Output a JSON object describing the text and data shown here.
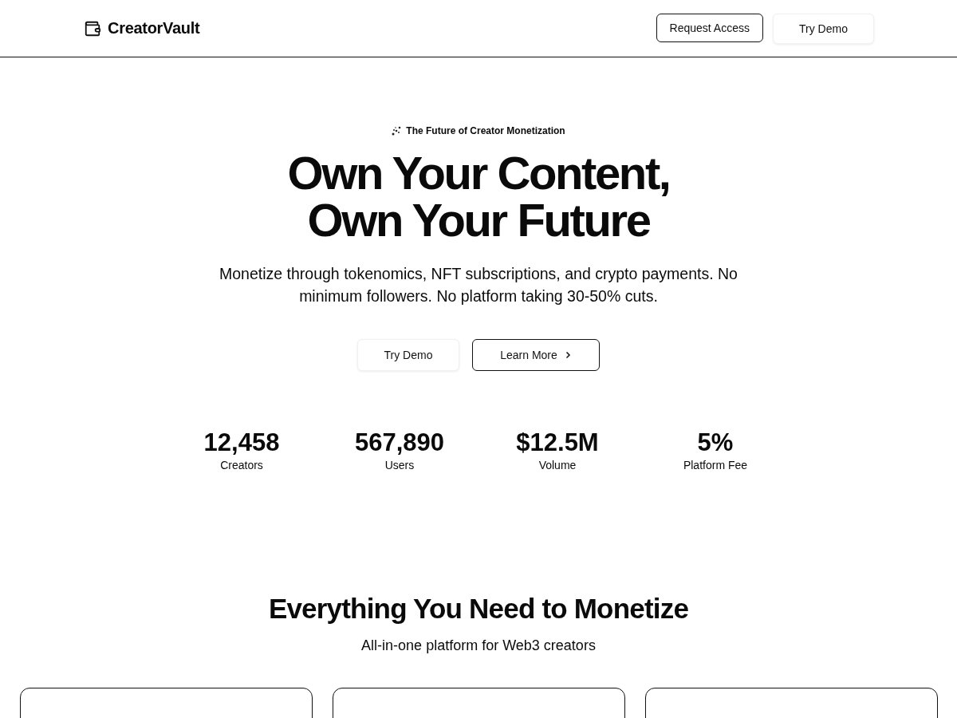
{
  "header": {
    "brand": "CreatorVault",
    "buttons": [
      {
        "label": "Request Access",
        "kind": "outline"
      },
      {
        "label": "Try Demo",
        "kind": "soft"
      }
    ]
  },
  "hero": {
    "badge": "The Future of Creator Monetization",
    "title_lines": [
      "Own Your Content,",
      "Own Your Future"
    ],
    "subtitle": "Monetize through tokenomics, NFT subscriptions, and crypto payments. No minimum followers. No platform taking 30-50% cuts.",
    "buttons": [
      {
        "label": "Try Demo",
        "kind": "soft"
      },
      {
        "label": "Learn More",
        "kind": "outline"
      }
    ]
  },
  "stats": [
    {
      "value": "12,458",
      "label": "Creators"
    },
    {
      "value": "567,890",
      "label": "Users"
    },
    {
      "value": "$12.5M",
      "label": "Volume"
    },
    {
      "value": "5%",
      "label": "Platform Fee"
    }
  ],
  "features": {
    "title": "Everything You Need to Monetize",
    "subtitle": "All-in-one platform for Web3 creators"
  }
}
